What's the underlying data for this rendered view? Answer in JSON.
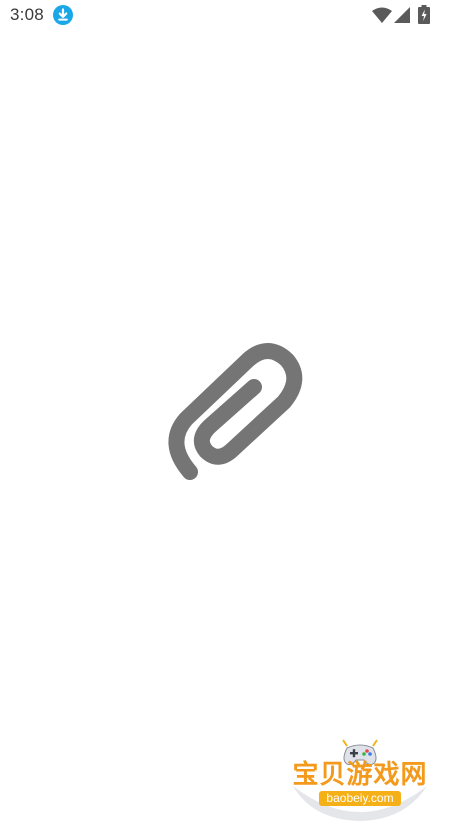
{
  "status_bar": {
    "time": "3:08",
    "icons": [
      "download-icon",
      "wifi-icon",
      "signal-icon",
      "battery-icon"
    ]
  },
  "splash": {
    "logo_icon": "paperclip-icon",
    "logo_color": "#757575"
  },
  "watermark": {
    "title": "宝贝游戏网",
    "url": "baobeiy.com",
    "icon": "gamepad-icon",
    "accent_color": "#f39a1c"
  },
  "colors": {
    "background": "#ffffff",
    "status_text": "#3a3a3a",
    "download_badge": "#1aa7e8"
  }
}
